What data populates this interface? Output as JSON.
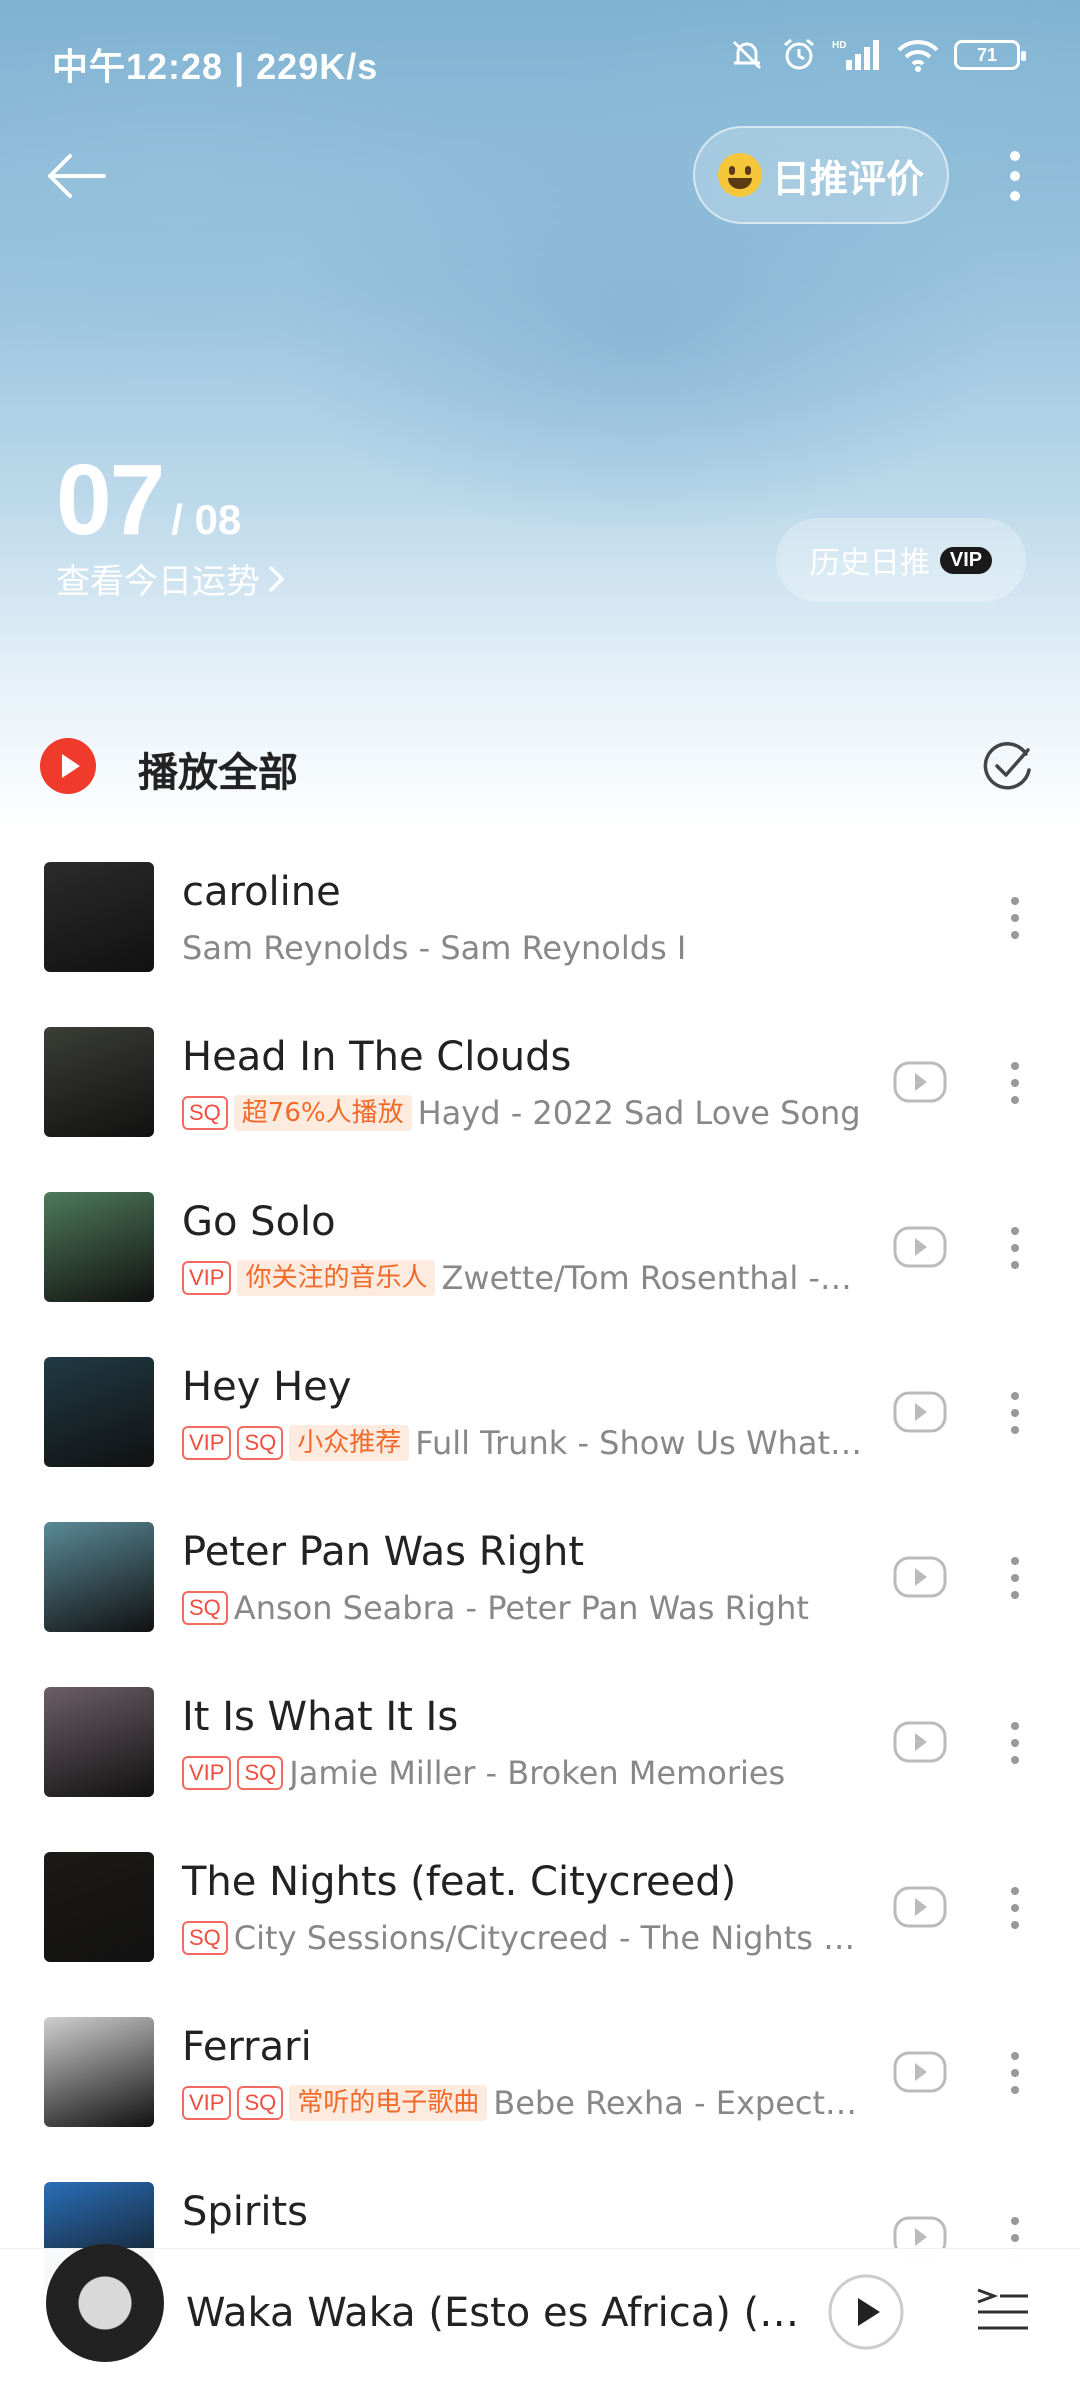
{
  "status_bar": {
    "time": "中午12:28 | 229K/s",
    "battery": "71"
  },
  "header": {
    "review_label": "日推评价"
  },
  "hero": {
    "day": "07",
    "month": "/ 08",
    "fortune_label": "查看今日运势",
    "history_label": "历史日推",
    "history_badge": "VIP"
  },
  "list_header": {
    "play_all": "播放全部"
  },
  "songs": [
    {
      "title": "caroline",
      "tags": [],
      "highlight": "",
      "artist": "Sam Reynolds - Sam Reynolds I",
      "cover_color": "#2b2b2b"
    },
    {
      "title": "Head In The Clouds",
      "tags": [
        "SQ"
      ],
      "highlight": "超76%人播放",
      "artist": "Hayd - 2022 Sad Love Song",
      "cover_color": "#3b3d37"
    },
    {
      "title": "Go Solo",
      "tags": [
        "VIP"
      ],
      "highlight": "你关注的音乐人",
      "artist": "Zwette/Tom Rosenthal -…",
      "cover_color": "#4e7a5b"
    },
    {
      "title": "Hey Hey",
      "tags": [
        "VIP",
        "SQ"
      ],
      "highlight": "小众推荐",
      "artist": "Full Trunk - Show Us What…",
      "cover_color": "#203a44"
    },
    {
      "title": "Peter Pan Was Right",
      "tags": [
        "SQ"
      ],
      "highlight": "",
      "artist": "Anson Seabra - Peter Pan Was Right",
      "cover_color": "#5a8a98"
    },
    {
      "title": "It Is What It Is",
      "tags": [
        "VIP",
        "SQ"
      ],
      "highlight": "",
      "artist": "Jamie Miller - Broken Memories",
      "cover_color": "#6b5f66"
    },
    {
      "title": "The Nights (feat. Citycreed)",
      "tags": [
        "SQ"
      ],
      "highlight": "",
      "artist": "City Sessions/Citycreed - The Nights (f…",
      "cover_color": "#1c1a16"
    },
    {
      "title": "Ferrari",
      "tags": [
        "VIP",
        "SQ"
      ],
      "highlight": "常听的电子歌曲",
      "artist": "Bebe Rexha - Expect…",
      "cover_color": "#cfcfcf"
    },
    {
      "title": "Spirits",
      "tags": [],
      "highlight": "",
      "artist": "",
      "cover_color": "#2a6fb8"
    }
  ],
  "mini_player": {
    "title": "Waka Waka (Esto es Africa) (…"
  }
}
